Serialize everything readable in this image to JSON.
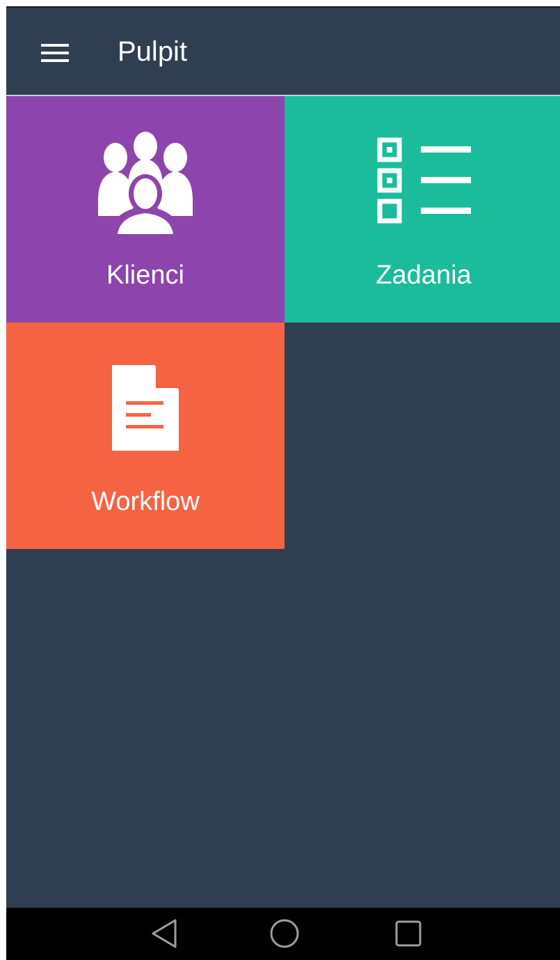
{
  "app_bar": {
    "title": "Pulpit",
    "menu_icon": "hamburger-menu-icon"
  },
  "tiles": [
    {
      "label": "Klienci",
      "icon": "people-group-icon",
      "color": "#8e44ad"
    },
    {
      "label": "Zadania",
      "icon": "checklist-icon",
      "color": "#1abc9c"
    },
    {
      "label": "Workflow",
      "icon": "document-icon",
      "color": "#f56342"
    }
  ],
  "colors": {
    "background": "#2f3e50",
    "nav_bar": "#000000",
    "accent_divider": "#c9cfd6"
  },
  "nav_bar": {
    "buttons": [
      "back-icon",
      "home-icon",
      "recents-icon"
    ]
  }
}
